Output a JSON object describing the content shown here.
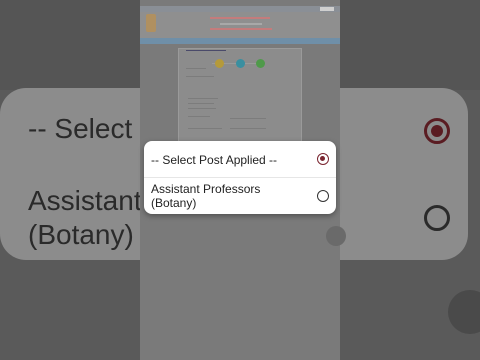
{
  "select_dialog": {
    "options": [
      {
        "label": "-- Select Post Applied --",
        "selected": true
      },
      {
        "label": "Assistant Professors (Botany)",
        "selected": false
      }
    ]
  },
  "background_zoom": {
    "option_1_text": "-- Select",
    "option_2_text": "Assistant\n(Botany)"
  },
  "colors": {
    "accent_radio": "#7a2530",
    "dialog_bg": "#ffffff",
    "overlay_bg": "#3c3c3c"
  }
}
